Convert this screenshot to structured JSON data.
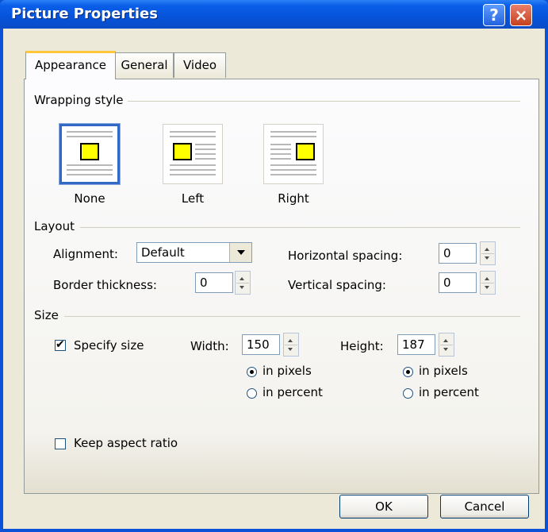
{
  "window": {
    "title": "Picture Properties",
    "help_glyph": "?",
    "close_glyph": "×"
  },
  "tabs": [
    {
      "label": "Appearance",
      "selected": true
    },
    {
      "label": "General",
      "selected": false
    },
    {
      "label": "Video",
      "selected": false
    }
  ],
  "wrapping": {
    "group_label": "Wrapping style",
    "options": [
      {
        "label": "None",
        "selected": true,
        "icon": "wrap-none-icon"
      },
      {
        "label": "Left",
        "selected": false,
        "icon": "wrap-left-icon"
      },
      {
        "label": "Right",
        "selected": false,
        "icon": "wrap-right-icon"
      }
    ]
  },
  "layout": {
    "group_label": "Layout",
    "alignment_label": "Alignment:",
    "alignment_value": "Default",
    "border_label": "Border thickness:",
    "border_value": "0",
    "hspacing_label": "Horizontal spacing:",
    "hspacing_value": "0",
    "vspacing_label": "Vertical spacing:",
    "vspacing_value": "0"
  },
  "size": {
    "group_label": "Size",
    "specify_label": "Specify size",
    "specify_checked": true,
    "width_label": "Width:",
    "width_value": "150",
    "height_label": "Height:",
    "height_value": "187",
    "in_pixels": "in pixels",
    "in_percent": "in percent",
    "width_units": "pixels",
    "height_units": "pixels",
    "keep_aspect_label": "Keep aspect ratio",
    "keep_aspect_checked": false
  },
  "buttons": {
    "ok": "OK",
    "cancel": "Cancel"
  },
  "colors": {
    "title_bar": "#0653da",
    "dialog_face": "#ece9d8",
    "selection_border": "#3169c6",
    "picture_fill": "#ffff00"
  }
}
